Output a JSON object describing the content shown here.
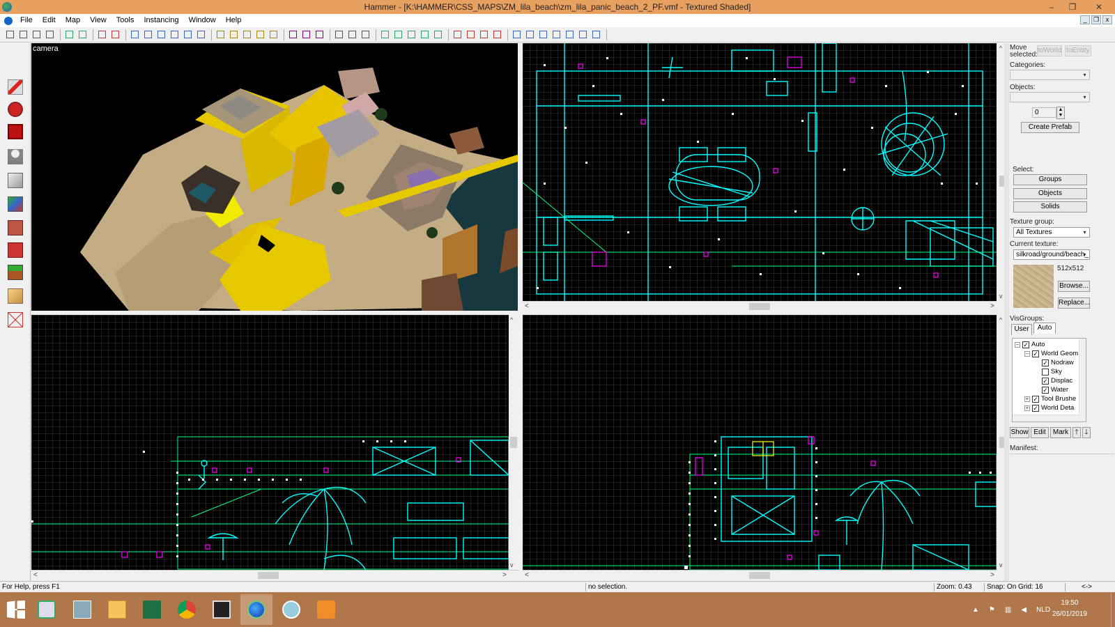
{
  "window": {
    "title": "Hammer - [K:\\HAMMER\\CSS_MAPS\\ZM_lila_beach\\zm_lila_panic_beach_2_PF.vmf - Textured Shaded]",
    "minimize": "–",
    "restore": "❐",
    "close": "✕"
  },
  "menu": [
    "File",
    "Edit",
    "Map",
    "View",
    "Tools",
    "Instancing",
    "Window",
    "Help"
  ],
  "viewports": {
    "camera_label": "camera"
  },
  "right_panel": {
    "move_selected": "Move selected:",
    "to_world": "toWorld",
    "to_entity": "toEntity",
    "categories": "Categories:",
    "objects": "Objects:",
    "prefab_count": "0",
    "create_prefab": "Create Prefab",
    "select": "Select:",
    "groups": "Groups",
    "objects_btn": "Objects",
    "solids": "Solids",
    "texture_group": "Texture group:",
    "texture_group_value": "All Textures",
    "current_texture": "Current texture:",
    "current_texture_value": "silkroad/ground/beach_",
    "texture_size": "512x512",
    "browse": "Browse...",
    "replace": "Replace...",
    "visgroups": "VisGroups:",
    "tab_user": "User",
    "tab_auto": "Auto",
    "tree": [
      {
        "label": "Auto",
        "checked": true,
        "level": 0,
        "pm": "–"
      },
      {
        "label": "World Geom",
        "checked": true,
        "level": 1,
        "pm": "–"
      },
      {
        "label": "Nodraw",
        "checked": true,
        "level": 2,
        "pm": ""
      },
      {
        "label": "Sky",
        "checked": false,
        "level": 2,
        "pm": ""
      },
      {
        "label": "Displac",
        "checked": true,
        "level": 2,
        "pm": ""
      },
      {
        "label": "Water",
        "checked": true,
        "level": 2,
        "pm": ""
      },
      {
        "label": "Tool Brushe",
        "checked": true,
        "level": 1,
        "pm": "+"
      },
      {
        "label": "World Deta",
        "checked": true,
        "level": 1,
        "pm": "+"
      }
    ],
    "show": "Show",
    "edit": "Edit",
    "mark": "Mark",
    "up": "🡑",
    "down": "🡓",
    "manifest": "Manifest:"
  },
  "status": {
    "help": "For Help, press F1",
    "selection": "no selection.",
    "zoom": "Zoom: 0.43",
    "snap": "Snap: On Grid: 16",
    "arrows": "<->"
  },
  "taskbar": {
    "lang": "NLD",
    "time": "19:50",
    "date": "26/01/2019"
  },
  "colors": {
    "titlebar": "#e8a060",
    "taskbar": "#b0784a",
    "wire_cyan": "#00ffff",
    "wire_magenta": "#ff00ff",
    "wire_white": "#ffffff",
    "grid": "#3a3a3a",
    "sand": "#c9b48c",
    "yellow": "#e6c800"
  }
}
